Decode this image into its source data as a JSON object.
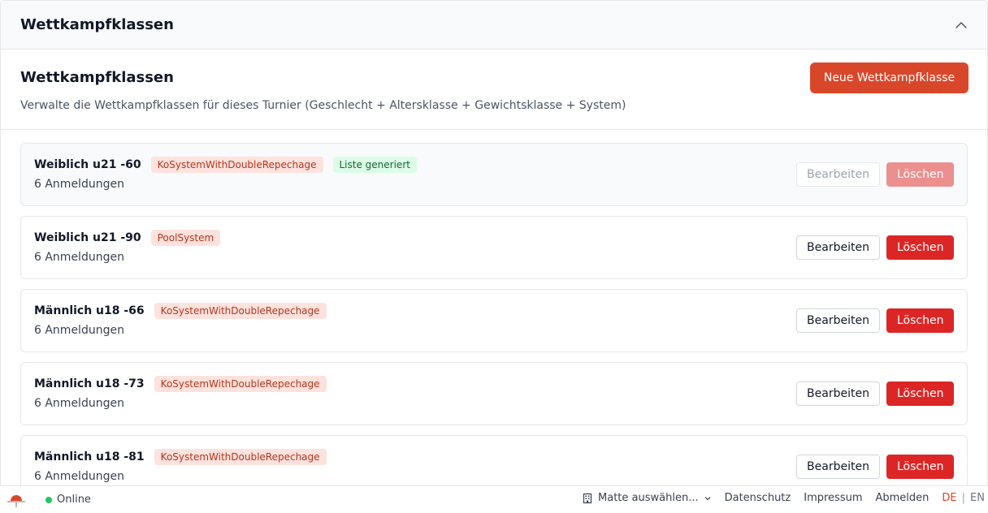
{
  "panel": {
    "title": "Wettkampfklassen"
  },
  "section": {
    "title": "Wettkampfklassen",
    "description": "Verwalte die Wettkampfklassen für dieses Turnier (Geschlecht + Altersklasse + Gewichtsklasse + System)",
    "new_button": "Neue Wettkampfklasse"
  },
  "classes": [
    {
      "name": "Weiblich u21 -60",
      "system": "KoSystemWithDoubleRepechage",
      "status": "Liste generiert",
      "registrations": "6 Anmeldungen",
      "edit": "Bearbeiten",
      "delete": "Löschen"
    },
    {
      "name": "Weiblich u21 -90",
      "system": "PoolSystem",
      "registrations": "6 Anmeldungen",
      "edit": "Bearbeiten",
      "delete": "Löschen"
    },
    {
      "name": "Männlich u18 -66",
      "system": "KoSystemWithDoubleRepechage",
      "registrations": "6 Anmeldungen",
      "edit": "Bearbeiten",
      "delete": "Löschen"
    },
    {
      "name": "Männlich u18 -73",
      "system": "KoSystemWithDoubleRepechage",
      "registrations": "6 Anmeldungen",
      "edit": "Bearbeiten",
      "delete": "Löschen"
    },
    {
      "name": "Männlich u18 -81",
      "system": "KoSystemWithDoubleRepechage",
      "registrations": "6 Anmeldungen",
      "edit": "Bearbeiten",
      "delete": "Löschen"
    }
  ],
  "footer": {
    "status": "Online",
    "mat_select": "Matte auswählen...",
    "privacy": "Datenschutz",
    "imprint": "Impressum",
    "logout": "Abmelden",
    "lang_de": "DE",
    "lang_sep": "|",
    "lang_en": "EN"
  },
  "colors": {
    "accent": "#d9472b",
    "danger": "#dc2626",
    "online": "#22c55e"
  }
}
